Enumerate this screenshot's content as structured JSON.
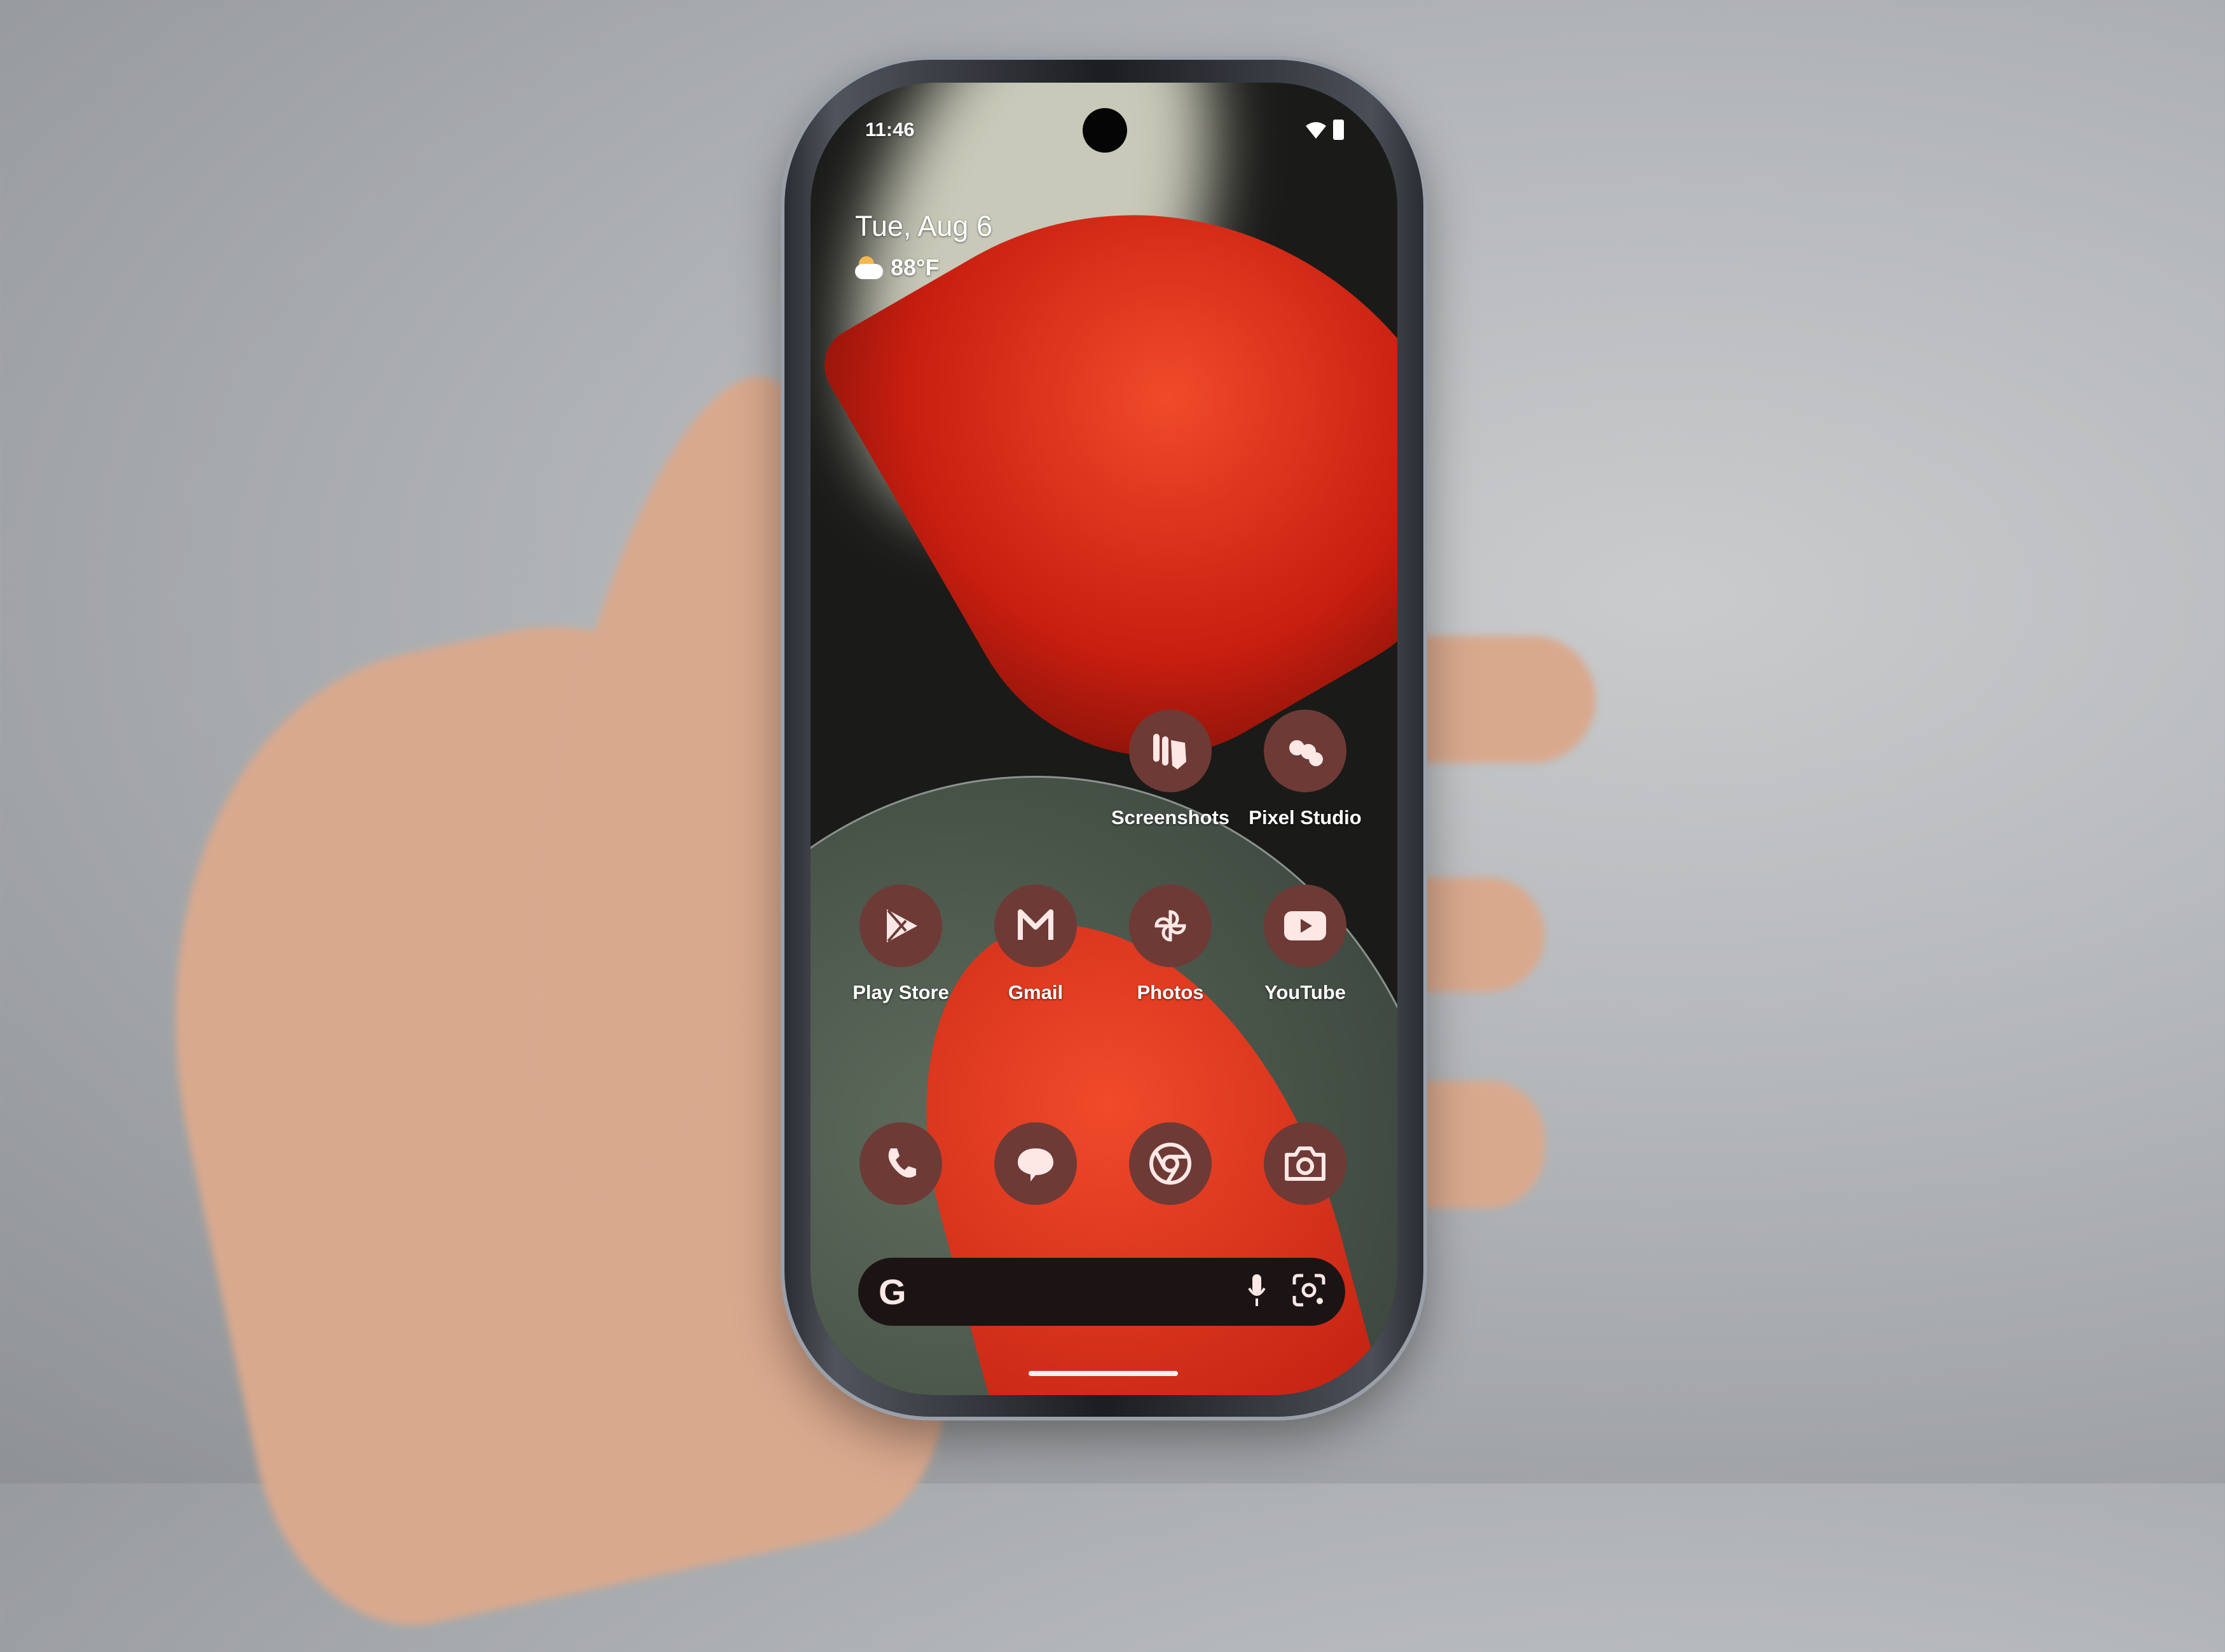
{
  "status_bar": {
    "time": "11:46",
    "icons": [
      "wifi-icon",
      "battery-icon"
    ]
  },
  "at_a_glance": {
    "date": "Tue, Aug 6",
    "weather_icon": "partly-cloudy-icon",
    "temperature": "88°F"
  },
  "apps_row1": [
    {
      "label": "Screenshots",
      "icon": "screenshots-icon"
    },
    {
      "label": "Pixel Studio",
      "icon": "pixel-studio-icon"
    }
  ],
  "apps_row2": [
    {
      "label": "Play Store",
      "icon": "play-store-icon"
    },
    {
      "label": "Gmail",
      "icon": "gmail-icon"
    },
    {
      "label": "Photos",
      "icon": "photos-icon"
    },
    {
      "label": "YouTube",
      "icon": "youtube-icon"
    }
  ],
  "dock": [
    {
      "icon": "phone-icon"
    },
    {
      "icon": "messages-icon"
    },
    {
      "icon": "chrome-icon"
    },
    {
      "icon": "camera-icon"
    }
  ],
  "search_bar": {
    "logo": "G",
    "icons": [
      "mic-icon",
      "lens-icon"
    ]
  },
  "colors": {
    "icon_bg": "#6e3a36",
    "icon_fg": "#fde8e6",
    "wallpaper_accent": "#e8301c"
  }
}
